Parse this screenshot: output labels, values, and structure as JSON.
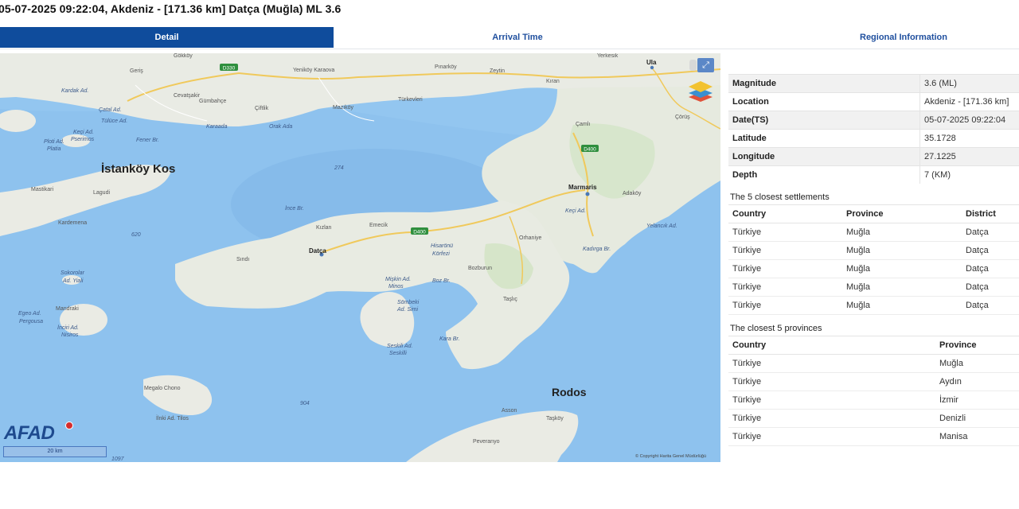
{
  "page": {
    "title": "05-07-2025 09:22:04, Akdeniz - [171.36 km] Datça (Muğla) ML 3.6"
  },
  "tabs": [
    {
      "label": "Detail",
      "active": true
    },
    {
      "label": "Arrival Time",
      "active": false
    },
    {
      "label": "Regional Information",
      "active": false
    }
  ],
  "map": {
    "brand": "AFAD",
    "scale_label": "20 km",
    "copyright": "© Copyright Harita Genel Müdürlüğü",
    "road_badges": [
      "D330",
      "D400",
      "D400"
    ],
    "place_labels": {
      "gokkoy": "Gökköy",
      "geris": "Geriş",
      "d330": "D330",
      "yenikoy": "Yeniköy Karaova",
      "pinarkoy": "Pınarköy",
      "zeytin": "Zeytin",
      "yerkesik": "Yerkesik",
      "ula": "Ula",
      "kardak": "Kardak Ad.",
      "cevatsakir": "Cevatşakir",
      "gumbahce": "Gümbahçe",
      "ciftlik": "Çiftlik",
      "mazikoy": "Mazıköy",
      "turkevleri": "Türkevleri",
      "kiran": "Kıran",
      "catal": "Çatal Ad.",
      "tulluce": "Tülüce Ad.",
      "camli": "Çamlı",
      "corus": "Çörüş",
      "keci": "Keçi Ad.",
      "pserimos": "Pserimos",
      "karaada": "Karaada",
      "orakada": "Orak Ada",
      "fener": "Fener Br.",
      "ploti": "Ploti Ad.",
      "platia": "Platia",
      "d400a": "D400",
      "istankoy": "İstanköy Kos",
      "n274": "274",
      "mastikari": "Mastikari",
      "lagudi": "Lagudi",
      "marmaris": "Marmaris",
      "adakoy": "Adaköy",
      "kardemena": "Kardemena",
      "ince": "İnce Br.",
      "kizlan": "Kızlan",
      "emecik": "Emecik",
      "d400b": "D400",
      "kecis": "Keçi Ad.",
      "yelanci": "Yelancık Ad.",
      "n620": "620",
      "sindi": "Sındı",
      "datca": "Datça",
      "hisaronu": "Hisarönü",
      "korfezi": "Körfezi",
      "orhaniye": "Orhaniye",
      "kadirga": "Kadırga Br.",
      "sokorolar": "Sokorolar",
      "yiali": "Ad. Yiali",
      "bozburun": "Bozburun",
      "msikin": "Mişkin Ad.",
      "minos": "Minos",
      "boz": "Boz Br.",
      "mandraki": "Mandraki",
      "sombeki": "Sömbeki",
      "simi": "Ad. Simi",
      "taslic": "Taşlıç",
      "egeo": "Egeo Ad.",
      "pergusa": "Pergousa",
      "inciri": "İnciri Ad.",
      "nisiros": "Nisiros",
      "kara": "Kara Br.",
      "seskili": "Seskili Ad.",
      "seskilii": "Seskilli",
      "megalo": "Megalo Chono",
      "ilnki": "İlnki Ad. Tilos",
      "n904": "904",
      "rodos": "Rodos",
      "asson": "Asson",
      "taskoy": "Taşköy",
      "peveranyo": "Peveranyo",
      "n1097": "1097"
    }
  },
  "details": [
    {
      "key": "Magnitude",
      "value": "3.6 (ML)"
    },
    {
      "key": "Location",
      "value": "Akdeniz - [171.36 km]"
    },
    {
      "key": "Date(TS)",
      "value": "05-07-2025 09:22:04"
    },
    {
      "key": "Latitude",
      "value": "35.1728"
    },
    {
      "key": "Longitude",
      "value": "27.1225"
    },
    {
      "key": "Depth",
      "value": "7 (KM)"
    }
  ],
  "settlements": {
    "title": "The 5 closest settlements",
    "headers": [
      "Country",
      "Province",
      "District"
    ],
    "rows": [
      [
        "Türkiye",
        "Muğla",
        "Datça"
      ],
      [
        "Türkiye",
        "Muğla",
        "Datça"
      ],
      [
        "Türkiye",
        "Muğla",
        "Datça"
      ],
      [
        "Türkiye",
        "Muğla",
        "Datça"
      ],
      [
        "Türkiye",
        "Muğla",
        "Datça"
      ]
    ]
  },
  "provinces": {
    "title": "The closest 5 provinces",
    "headers": [
      "Country",
      "Province"
    ],
    "rows": [
      [
        "Türkiye",
        "Muğla"
      ],
      [
        "Türkiye",
        "Aydın"
      ],
      [
        "Türkiye",
        "İzmir"
      ],
      [
        "Türkiye",
        "Denizli"
      ],
      [
        "Türkiye",
        "Manisa"
      ]
    ]
  }
}
